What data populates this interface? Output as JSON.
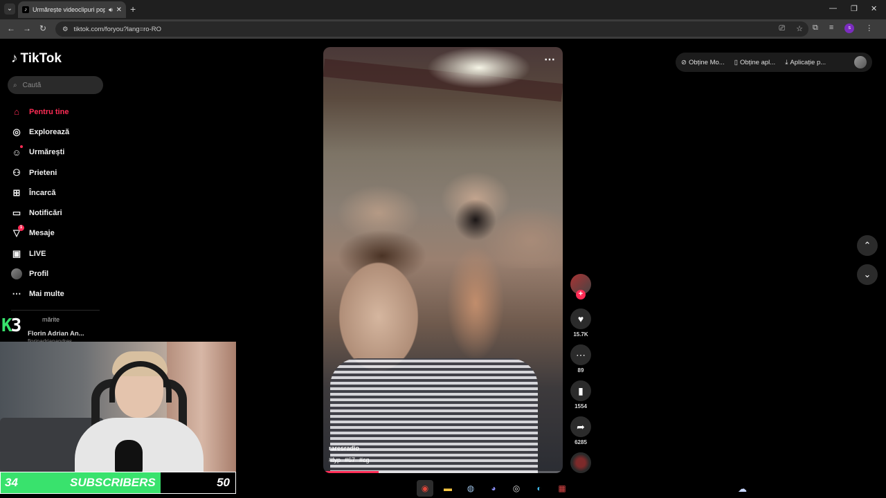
{
  "browser": {
    "tab_title": "Urmărește videoclipuri pop",
    "url": "tiktok.com/foryou?lang=ro-RO",
    "profile_initial": "s"
  },
  "tiktok": {
    "logo": "TikTok",
    "search_placeholder": "Caută",
    "menu": [
      {
        "label": "Pentru tine",
        "icon": "home-icon"
      },
      {
        "label": "Explorează",
        "icon": "compass-icon"
      },
      {
        "label": "Urmărești",
        "icon": "following-icon"
      },
      {
        "label": "Prieteni",
        "icon": "friends-icon"
      },
      {
        "label": "Încarcă",
        "icon": "upload-icon"
      },
      {
        "label": "Notificări",
        "icon": "notifications-icon"
      },
      {
        "label": "Mesaje",
        "icon": "messages-icon",
        "badge": "1"
      },
      {
        "label": "LIVE",
        "icon": "live-icon"
      },
      {
        "label": "Profil",
        "icon": "profile-avatar"
      },
      {
        "label": "Mai multe",
        "icon": "more-icon"
      }
    ],
    "following_section_label": "mărite",
    "following_user_name": "Florin Adrian An...",
    "following_user_handle": "florinadrianandres"
  },
  "video": {
    "author": "raresradio",
    "hashtags": [
      "#fyp",
      "#67",
      "#cg"
    ],
    "progress": 0.23,
    "likes": "15.7K",
    "comments": "89",
    "saves": "1554",
    "shares": "6285"
  },
  "topbar": {
    "pill1": "Obține Mo...",
    "pill2": "Obține apl...",
    "pill3": "Aplicație p..."
  },
  "overlay": {
    "logo_k": "K",
    "logo_3": "3",
    "subs_current": "34",
    "subs_label": "SUBSCRIBERS",
    "subs_goal": "50",
    "subs_progress": 0.68
  },
  "colors": {
    "tiktok_accent": "#fe2c55",
    "subs_fill": "#39e26d"
  }
}
